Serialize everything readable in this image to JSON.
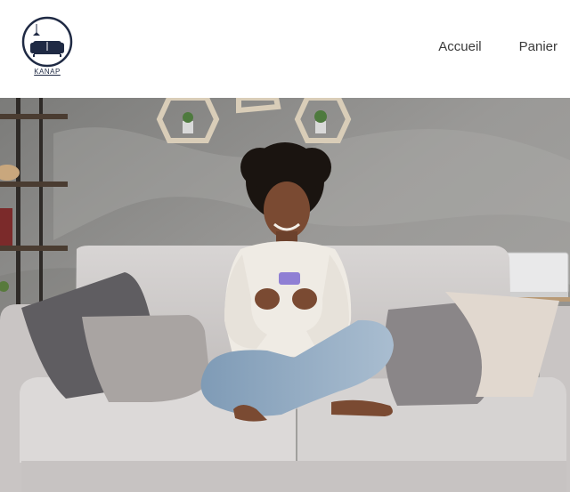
{
  "brand": {
    "name": "KANAP",
    "logo_icon": "sofa-lamp-logo-icon"
  },
  "nav": {
    "items": [
      {
        "label": "Accueil"
      },
      {
        "label": "Panier"
      }
    ]
  },
  "hero": {
    "image": "hero-photo-woman-on-sofa"
  },
  "colors": {
    "brand_navy": "#1f2a44",
    "nav_text": "#3a3a3a",
    "wall_gray": "#8d8d8b",
    "sofa_gray": "#cfcccb"
  }
}
